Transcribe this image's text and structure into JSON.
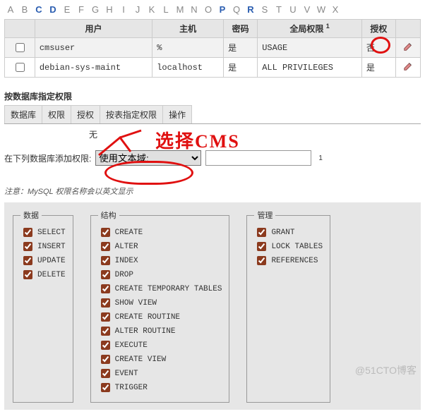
{
  "alpha": [
    "A",
    "B",
    "C",
    "D",
    "E",
    "F",
    "G",
    "H",
    "I",
    "J",
    "K",
    "L",
    "M",
    "N",
    "O",
    "P",
    "Q",
    "R",
    "S",
    "T",
    "U",
    "V",
    "W",
    "X"
  ],
  "alpha_active": [
    "C",
    "D",
    "P",
    "R"
  ],
  "users_table": {
    "headers": {
      "user": "用户",
      "host": "主机",
      "pass": "密码",
      "global": "全局权限",
      "sup": "1",
      "grant": "授权",
      "action": ""
    },
    "rows": [
      {
        "user": "cmsuser",
        "host": "%",
        "pass": "是",
        "priv": "USAGE",
        "grant": "否"
      },
      {
        "user": "debian-sys-maint",
        "host": "localhost",
        "pass": "是",
        "priv": "ALL PRIVILEGES",
        "grant": "是"
      }
    ]
  },
  "db_priv": {
    "title": "按数据库指定权限",
    "tabs": [
      "数据库",
      "权限",
      "授权",
      "按表指定权限",
      "操作"
    ],
    "none": "无",
    "add_label": "在下列数据库添加权限:",
    "select_placeholder": "使用文本域:",
    "footnote": "1"
  },
  "note": "注意：MySQL 权限名称会以英文显示",
  "priv_groups": {
    "data": {
      "legend": "数据",
      "items": [
        "SELECT",
        "INSERT",
        "UPDATE",
        "DELETE"
      ]
    },
    "structure": {
      "legend": "结构",
      "items": [
        "CREATE",
        "ALTER",
        "INDEX",
        "DROP",
        "CREATE TEMPORARY TABLES",
        "SHOW VIEW",
        "CREATE ROUTINE",
        "ALTER ROUTINE",
        "EXECUTE",
        "CREATE VIEW",
        "EVENT",
        "TRIGGER"
      ]
    },
    "admin": {
      "legend": "管理",
      "items": [
        "GRANT",
        "LOCK TABLES",
        "REFERENCES"
      ]
    }
  },
  "watermark": "@51CTO博客",
  "annotation": "选择CMS"
}
